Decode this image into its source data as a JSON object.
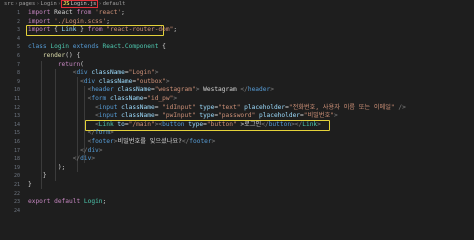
{
  "breadcrumb": {
    "items": [
      "src",
      "pages",
      "Login",
      "Login.js",
      "default"
    ],
    "js_badge": "JS"
  },
  "line_numbers": [
    "1",
    "2",
    "3",
    "4",
    "5",
    "6",
    "7",
    "8",
    "9",
    "10",
    "11",
    "12",
    "13",
    "14",
    "15",
    "16",
    "17",
    "18",
    "19",
    "20",
    "21",
    "22",
    "23",
    "24"
  ],
  "code": [
    [
      {
        "t": "import",
        "c": "kw"
      },
      {
        "t": " React ",
        "c": "txt"
      },
      {
        "t": "from",
        "c": "kw"
      },
      {
        "t": " 'react'",
        "c": "str"
      },
      {
        "t": ";",
        "c": "pn"
      }
    ],
    [
      {
        "t": "import",
        "c": "kw"
      },
      {
        "t": " './Login.scss'",
        "c": "str"
      },
      {
        "t": ";",
        "c": "pn"
      }
    ],
    [
      {
        "t": "import",
        "c": "kw"
      },
      {
        "t": " { ",
        "c": "pn"
      },
      {
        "t": "Link",
        "c": "attr"
      },
      {
        "t": " } ",
        "c": "pn"
      },
      {
        "t": "from",
        "c": "kw"
      },
      {
        "t": " \"react-router-dom\"",
        "c": "str"
      },
      {
        "t": ";",
        "c": "pn"
      }
    ],
    [],
    [
      {
        "t": "class",
        "c": "kb"
      },
      {
        "t": " Login ",
        "c": "cls"
      },
      {
        "t": "extends",
        "c": "kb"
      },
      {
        "t": " React",
        "c": "cls"
      },
      {
        "t": ".",
        "c": "pn"
      },
      {
        "t": "Component",
        "c": "cls"
      },
      {
        "t": " {",
        "c": "pn"
      }
    ],
    [
      {
        "t": "    ",
        "c": "txt"
      },
      {
        "t": "render",
        "c": "fn"
      },
      {
        "t": "() {",
        "c": "pn"
      }
    ],
    [
      {
        "t": "        ",
        "c": "txt"
      },
      {
        "t": "return",
        "c": "kw"
      },
      {
        "t": "(",
        "c": "pn"
      }
    ],
    [
      {
        "t": "            ",
        "c": "txt"
      },
      {
        "t": "<",
        "c": "gr"
      },
      {
        "t": "div",
        "c": "tag"
      },
      {
        "t": " className",
        "c": "attr"
      },
      {
        "t": "=",
        "c": "pn"
      },
      {
        "t": "\"Login\"",
        "c": "str"
      },
      {
        "t": ">",
        "c": "gr"
      }
    ],
    [
      {
        "t": "              ",
        "c": "txt"
      },
      {
        "t": "<",
        "c": "gr"
      },
      {
        "t": "div",
        "c": "tag"
      },
      {
        "t": " className",
        "c": "attr"
      },
      {
        "t": "=",
        "c": "pn"
      },
      {
        "t": "\"outbox\"",
        "c": "str"
      },
      {
        "t": ">",
        "c": "gr"
      }
    ],
    [
      {
        "t": "                ",
        "c": "txt"
      },
      {
        "t": "<",
        "c": "gr"
      },
      {
        "t": "header",
        "c": "tag"
      },
      {
        "t": " className",
        "c": "attr"
      },
      {
        "t": "=",
        "c": "pn"
      },
      {
        "t": "\"westagram\"",
        "c": "str"
      },
      {
        "t": ">",
        "c": "gr"
      },
      {
        "t": " Westagram ",
        "c": "txt"
      },
      {
        "t": "</",
        "c": "gr"
      },
      {
        "t": "header",
        "c": "tag"
      },
      {
        "t": ">",
        "c": "gr"
      }
    ],
    [
      {
        "t": "                ",
        "c": "txt"
      },
      {
        "t": "<",
        "c": "gr"
      },
      {
        "t": "form",
        "c": "tag"
      },
      {
        "t": " className",
        "c": "attr"
      },
      {
        "t": "=",
        "c": "pn"
      },
      {
        "t": "\"id_pw\"",
        "c": "str"
      },
      {
        "t": ">",
        "c": "gr"
      }
    ],
    [
      {
        "t": "                  ",
        "c": "txt"
      },
      {
        "t": "<",
        "c": "gr"
      },
      {
        "t": "input",
        "c": "tag"
      },
      {
        "t": " className",
        "c": "attr"
      },
      {
        "t": "= ",
        "c": "pn"
      },
      {
        "t": "\"idInput\"",
        "c": "str"
      },
      {
        "t": " type",
        "c": "attr"
      },
      {
        "t": "=",
        "c": "pn"
      },
      {
        "t": "\"text\"",
        "c": "str"
      },
      {
        "t": " placeholder",
        "c": "attr"
      },
      {
        "t": "=",
        "c": "pn"
      },
      {
        "t": "\"전화번호, 사용자 이름 또는 이메일\"",
        "c": "str"
      },
      {
        "t": " />",
        "c": "gr"
      }
    ],
    [
      {
        "t": "                  ",
        "c": "txt"
      },
      {
        "t": "<",
        "c": "gr"
      },
      {
        "t": "input",
        "c": "tag"
      },
      {
        "t": " className",
        "c": "attr"
      },
      {
        "t": "= ",
        "c": "pn"
      },
      {
        "t": "\"pwInput\"",
        "c": "str"
      },
      {
        "t": " type",
        "c": "attr"
      },
      {
        "t": "=",
        "c": "pn"
      },
      {
        "t": "\"password\"",
        "c": "str"
      },
      {
        "t": " placeholder",
        "c": "attr"
      },
      {
        "t": "=",
        "c": "pn"
      },
      {
        "t": "\"비밀번호\"",
        "c": "str"
      },
      {
        "t": ">",
        "c": "gr"
      }
    ],
    [
      {
        "t": "                  ",
        "c": "txt"
      },
      {
        "t": "<",
        "c": "gr"
      },
      {
        "t": "Link",
        "c": "cls"
      },
      {
        "t": " to",
        "c": "attr"
      },
      {
        "t": "=",
        "c": "pn"
      },
      {
        "t": "\"/main\"",
        "c": "str"
      },
      {
        "t": ">",
        "c": "gr"
      },
      {
        "t": "<",
        "c": "gr"
      },
      {
        "t": "button",
        "c": "tag"
      },
      {
        "t": " type",
        "c": "attr"
      },
      {
        "t": "=",
        "c": "pn"
      },
      {
        "t": "\"button\"",
        "c": "str"
      },
      {
        "t": " >로그인",
        "c": "txt"
      },
      {
        "t": "</",
        "c": "gr"
      },
      {
        "t": "button",
        "c": "tag"
      },
      {
        "t": "></",
        "c": "gr"
      },
      {
        "t": "Link",
        "c": "cls"
      },
      {
        "t": ">",
        "c": "gr"
      }
    ],
    [
      {
        "t": "                ",
        "c": "txt"
      },
      {
        "t": "</",
        "c": "gr"
      },
      {
        "t": "form",
        "c": "tag"
      },
      {
        "t": ">",
        "c": "gr"
      }
    ],
    [
      {
        "t": "                ",
        "c": "txt"
      },
      {
        "t": "<",
        "c": "gr"
      },
      {
        "t": "footer",
        "c": "tag"
      },
      {
        "t": ">",
        "c": "gr"
      },
      {
        "t": "비밀번호를 잊으셨나요?",
        "c": "txt"
      },
      {
        "t": "</",
        "c": "gr"
      },
      {
        "t": "footer",
        "c": "tag"
      },
      {
        "t": ">",
        "c": "gr"
      }
    ],
    [
      {
        "t": "              ",
        "c": "txt"
      },
      {
        "t": "</",
        "c": "gr"
      },
      {
        "t": "div",
        "c": "tag"
      },
      {
        "t": ">",
        "c": "gr"
      }
    ],
    [
      {
        "t": "            ",
        "c": "txt"
      },
      {
        "t": "</",
        "c": "gr"
      },
      {
        "t": "div",
        "c": "tag"
      },
      {
        "t": ">",
        "c": "gr"
      }
    ],
    [
      {
        "t": "        ",
        "c": "txt"
      },
      {
        "t": ");",
        "c": "pn"
      }
    ],
    [
      {
        "t": "    ",
        "c": "txt"
      },
      {
        "t": "}",
        "c": "pn"
      }
    ],
    [
      {
        "t": "}",
        "c": "pn"
      }
    ],
    [],
    [
      {
        "t": "export",
        "c": "kw"
      },
      {
        "t": " ",
        "c": "txt"
      },
      {
        "t": "default",
        "c": "kw"
      },
      {
        "t": " Login",
        "c": "cls"
      },
      {
        "t": ";",
        "c": "pn"
      }
    ],
    []
  ],
  "colors": {
    "background": "#1e1e1e",
    "highlight_box": "#e4d23a",
    "active_tab_outline": "#e0303a"
  }
}
